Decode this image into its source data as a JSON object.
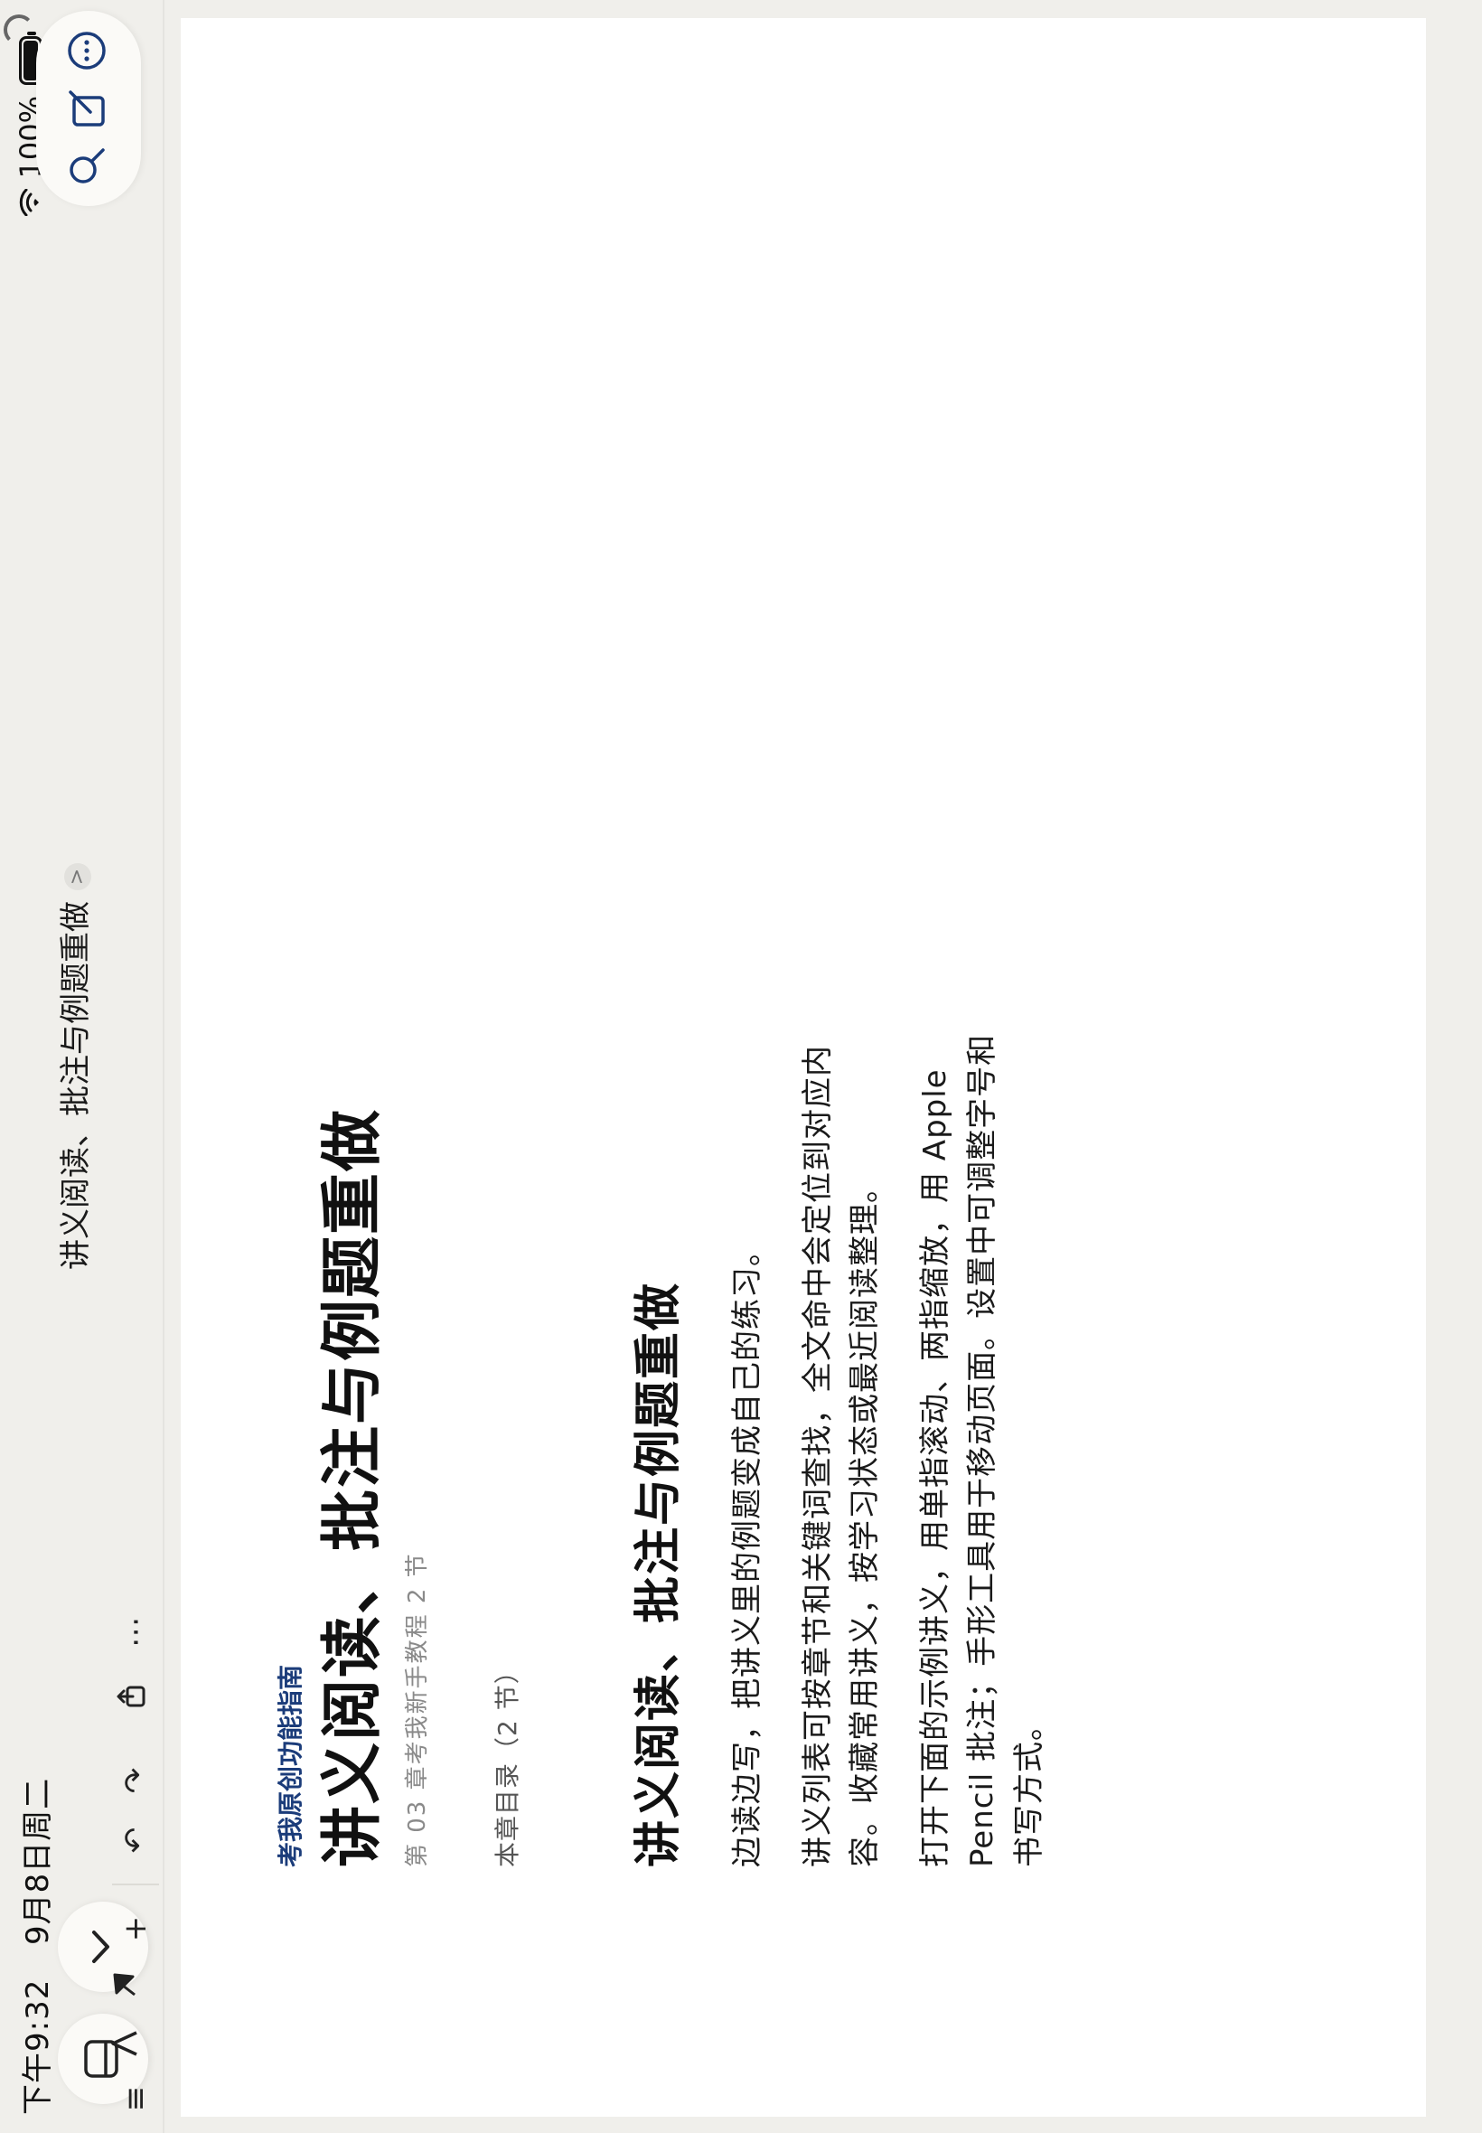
{
  "status": {
    "time": "下午9:32",
    "date": "9月8日周二",
    "battery_percent": "100%",
    "battery_level": 1.0
  },
  "header": {
    "doc_title": "讲义阅读、批注与例题重做",
    "chevron": ">"
  },
  "icons": {
    "sidebar": "sidebar-icon",
    "collapse": "chevron-down-icon",
    "search": "search-icon",
    "compose": "compose-icon",
    "more": "more-circle-icon",
    "list": "list-icon",
    "pen": "pen-icon",
    "lasso": "arrow-tool-icon",
    "add": "plus-icon",
    "undo": "undo-icon",
    "redo": "redo-icon",
    "share": "share-icon",
    "overflow": "ellipsis-icon"
  },
  "toolbar": {
    "list_glyph": "≡",
    "add_glyph": "+",
    "undo_glyph": "↶",
    "redo_glyph": "↷",
    "overflow_glyph": "⋯"
  },
  "document": {
    "brand": "考我原创功能指南",
    "title": "讲义阅读、批注与例题重做",
    "meta": "第 03 章考我新手教程 2 节",
    "toc_label": "本章目录（2 节）",
    "section_title": "讲义阅读、批注与例题重做",
    "paragraphs": [
      "边读边写，把讲义里的例题变成自己的练习。",
      "讲义列表可按章节和关键词查找，全文命中会定位到对应内容。收藏常用讲义，按学习状态或最近阅读整理。",
      "打开下面的示例讲义，用单指滚动、两指缩放，用 Apple Pencil 批注；手形工具用于移动页面。设置中可调整字号和书写方式。"
    ]
  },
  "colors": {
    "background": "#f0efeb",
    "page": "#ffffff",
    "brand": "#1b3c7a"
  }
}
